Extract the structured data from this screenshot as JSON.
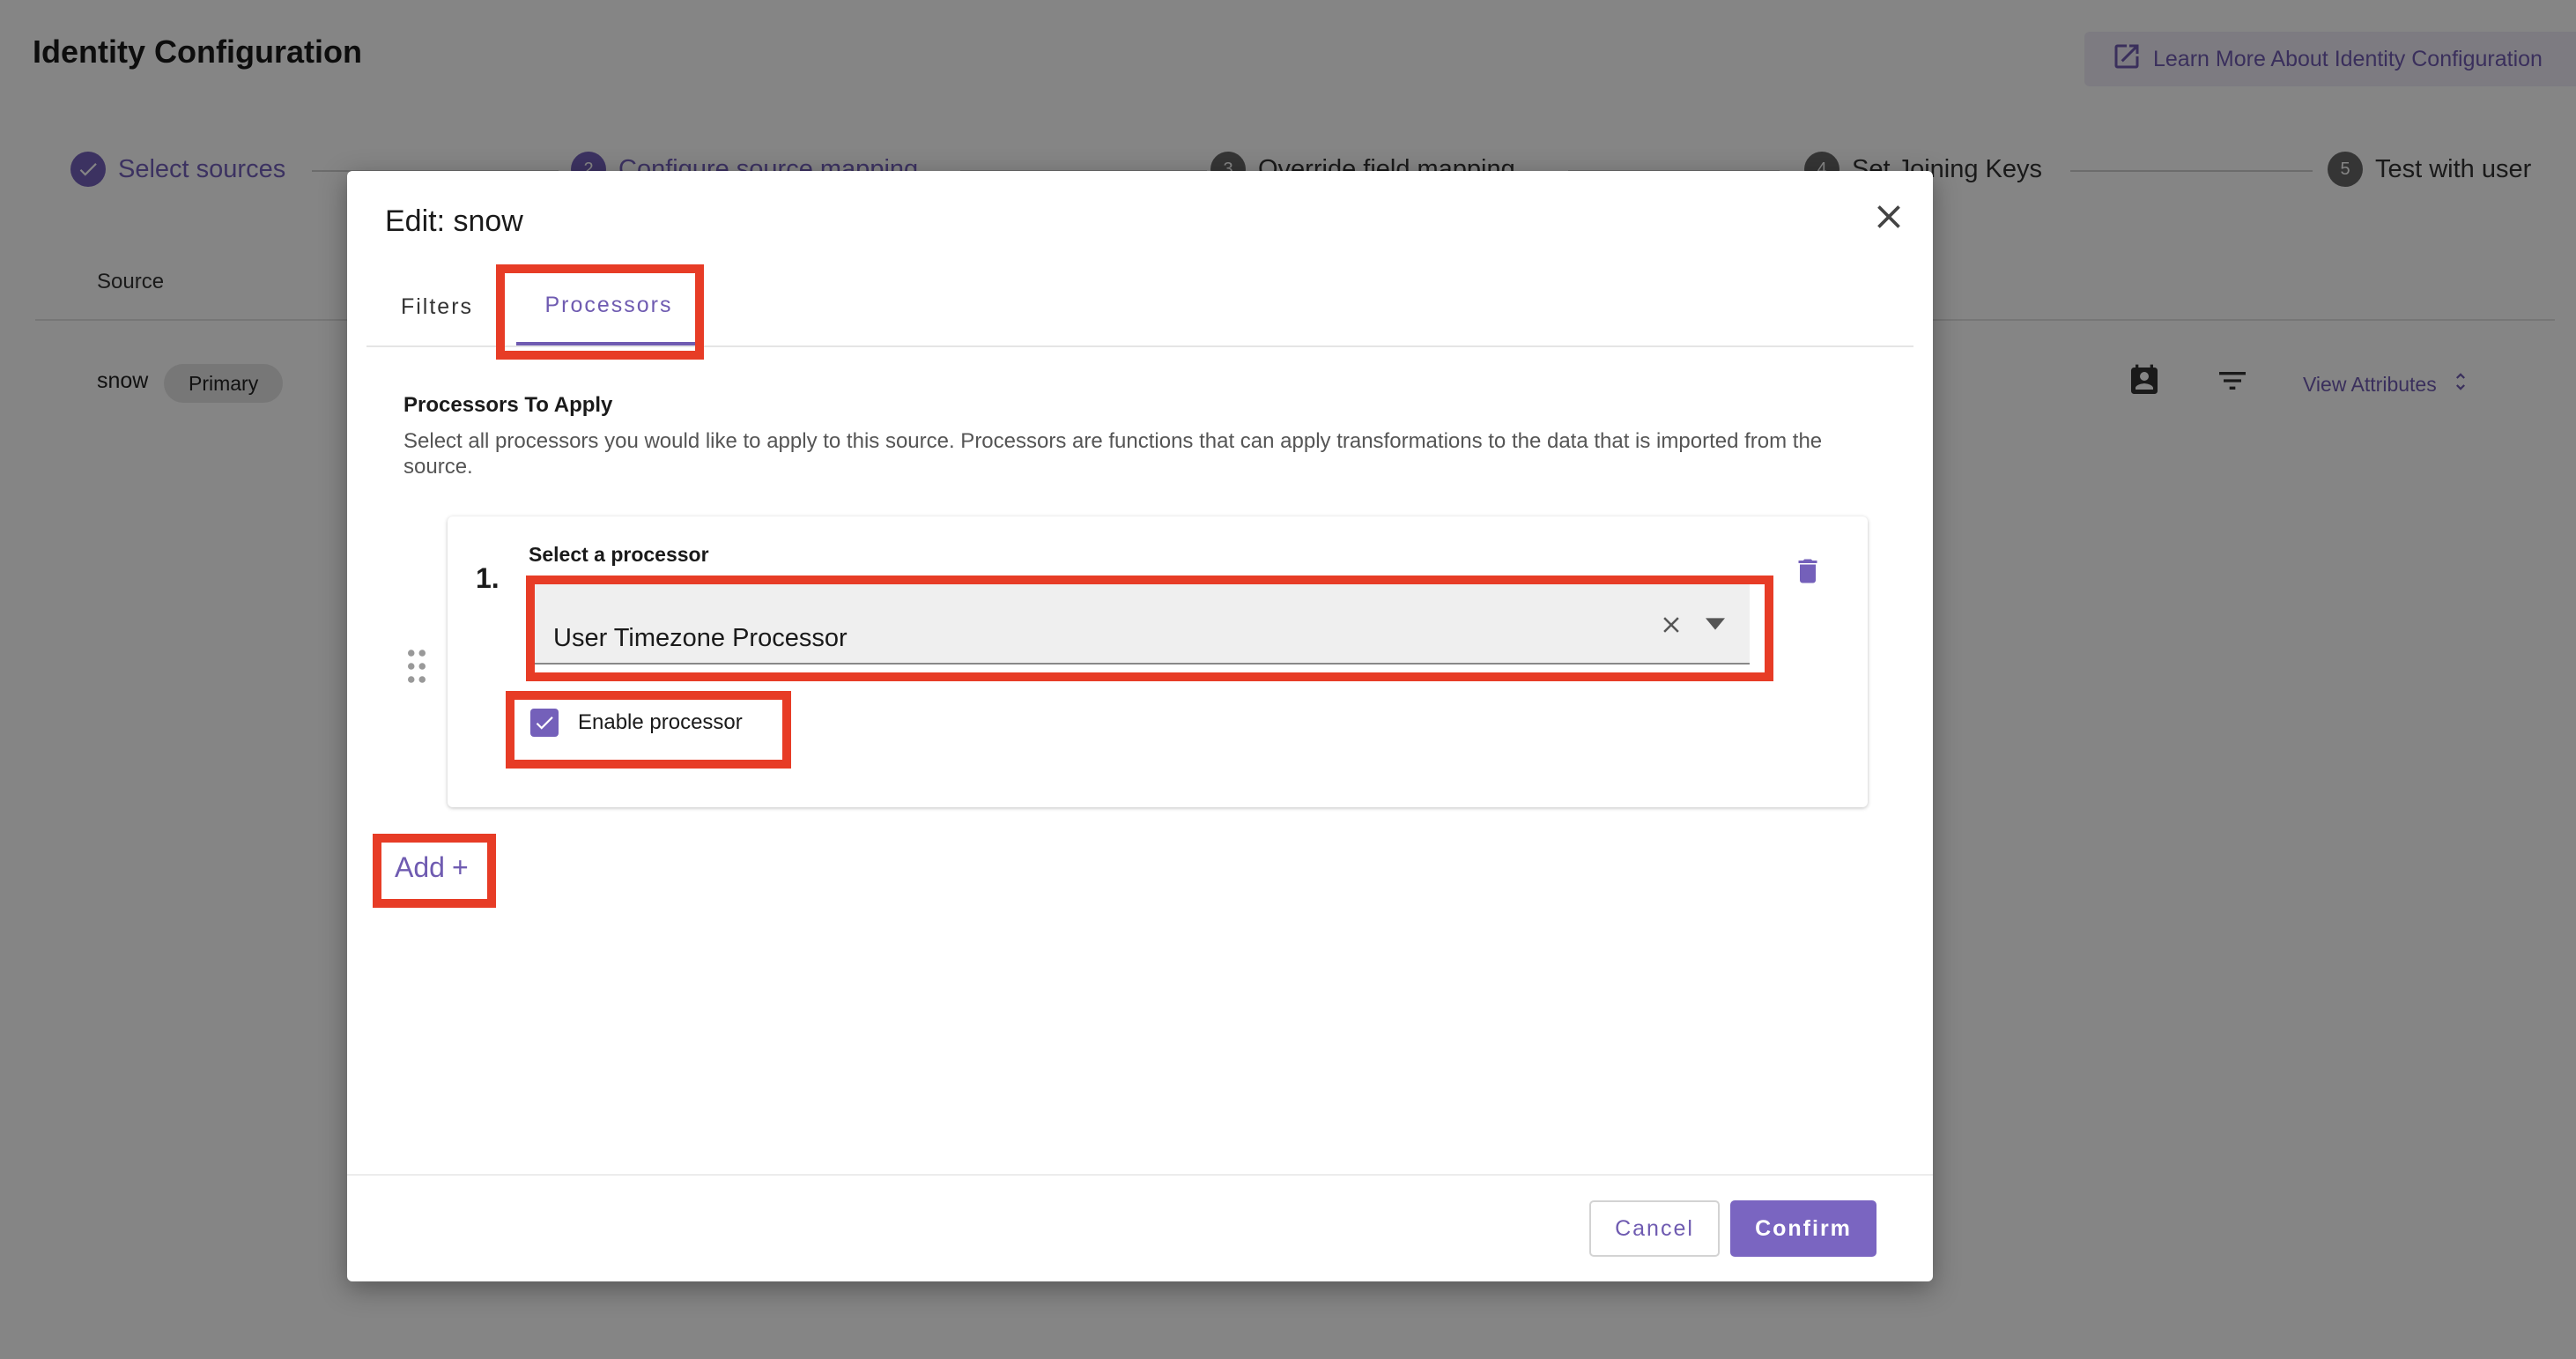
{
  "page": {
    "title": "Identity Configuration",
    "learn_more": "Learn More About Identity Configuration"
  },
  "stepper": {
    "steps": [
      {
        "number": "1",
        "label": "Select sources",
        "state": "done"
      },
      {
        "number": "2",
        "label": "Configure source mapping",
        "state": "active"
      },
      {
        "number": "3",
        "label": "Override field mapping",
        "state": "pending"
      },
      {
        "number": "4",
        "label": "Set Joining Keys",
        "state": "pending"
      },
      {
        "number": "5",
        "label": "Test with user",
        "state": "pending"
      }
    ]
  },
  "table": {
    "header_source": "Source",
    "row": {
      "source": "snow",
      "badge": "Primary",
      "view_attributes": "View Attributes"
    }
  },
  "modal": {
    "title": "Edit: snow",
    "tabs": [
      {
        "label": "Filters",
        "selected": false
      },
      {
        "label": "Processors",
        "selected": true
      }
    ],
    "section_title": "Processors To Apply",
    "section_description": "Select all processors you would like to apply to this source. Processors are functions that can apply transformations to the data that is imported from the source.",
    "processor": {
      "number": "1.",
      "select_label": "Select a processor",
      "selected_value": "User Timezone Processor",
      "enable_label": "Enable processor",
      "enabled": true
    },
    "add_label": "Add",
    "add_symbol": "+",
    "cancel_label": "Cancel",
    "confirm_label": "Confirm"
  },
  "colors": {
    "accent": "#7460ba",
    "highlight": "#e73c26",
    "overlay": "rgba(0,0,0,0.48)"
  }
}
